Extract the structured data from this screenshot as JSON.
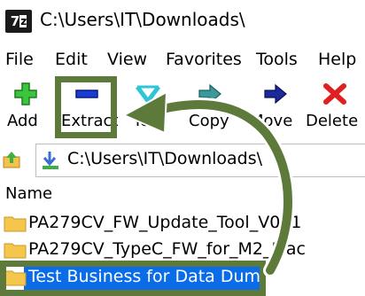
{
  "window": {
    "title": "C:\\Users\\IT\\Downloads\\",
    "app_icon_text": "7z"
  },
  "menu": [
    "File",
    "Edit",
    "View",
    "Favorites",
    "Tools",
    "Help"
  ],
  "toolbar": {
    "add": "Add",
    "extract": "Extract",
    "test": "Test",
    "copy": "Copy",
    "move": "Move",
    "delete": "Delete"
  },
  "address": {
    "path": "C:\\Users\\IT\\Downloads\\"
  },
  "list": {
    "column_name": "Name",
    "items": [
      {
        "name": "PA279CV_FW_Update_Tool_V021",
        "selected": false
      },
      {
        "name": "PA279CV_TypeC_FW_for_M2_Mac",
        "selected": false
      },
      {
        "name": "Test Business for Data Dump",
        "selected": true
      }
    ]
  },
  "annotation": {
    "color": "#5e7a3a",
    "selection_color": "#0a6ce8"
  }
}
